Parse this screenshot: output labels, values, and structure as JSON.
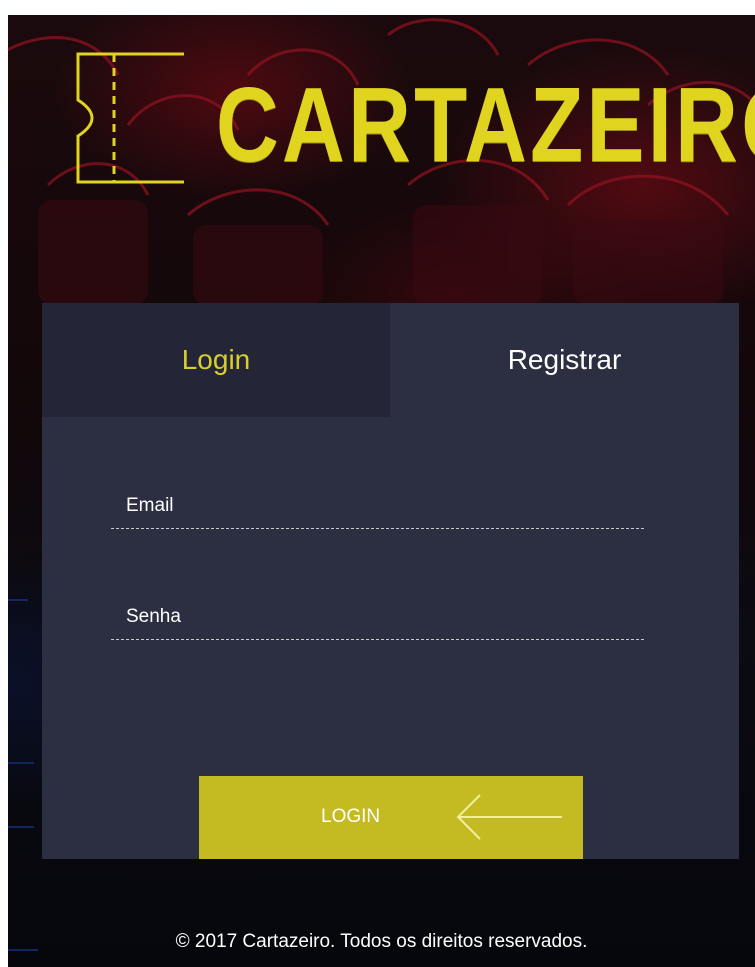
{
  "brand": {
    "name": "CARTAZEIRO",
    "color": "#e0d41f",
    "logo_icon": "ticket-icon"
  },
  "tabs": [
    {
      "label": "Login",
      "active": true,
      "color": "#d8cf2b"
    },
    {
      "label": "Registrar",
      "active": false,
      "color": "#ffffff"
    }
  ],
  "form": {
    "email": {
      "placeholder": "Email",
      "value": ""
    },
    "senha": {
      "placeholder": "Senha",
      "value": ""
    },
    "submit": {
      "label": "LOGIN",
      "icon": "arrow-left-icon",
      "color": "#c4ba22"
    }
  },
  "footer": {
    "text": "© 2017 Cartazeiro. Todos os direitos reservados."
  },
  "colors": {
    "card": "#2c2f42",
    "tab_active_bg": "#242638"
  }
}
